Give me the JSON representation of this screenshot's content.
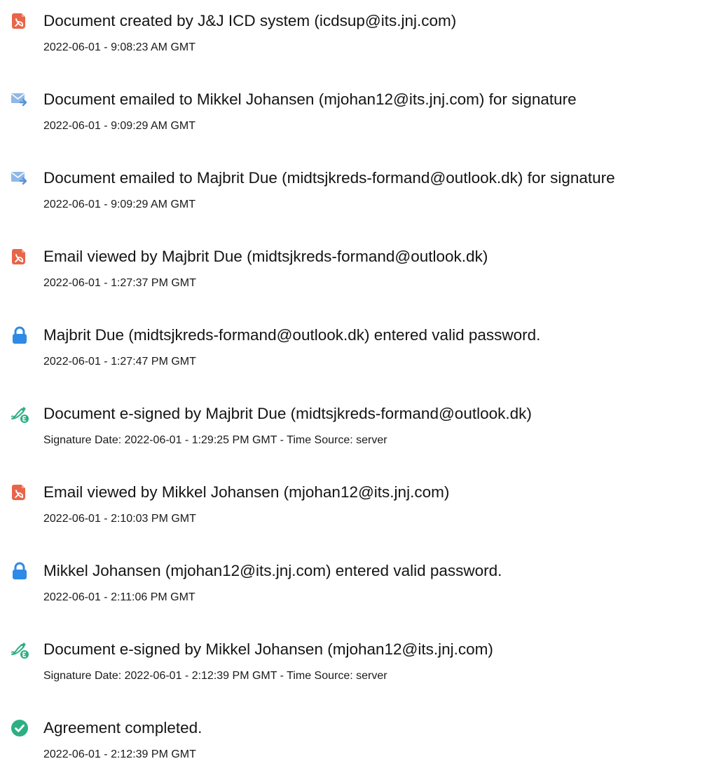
{
  "events": [
    {
      "icon": "pdf-document-icon",
      "title": "Document created by J&J ICD system (icdsup@its.jnj.com)",
      "sub": "2022-06-01 - 9:08:23 AM GMT"
    },
    {
      "icon": "email-sent-icon",
      "title": "Document emailed to Mikkel Johansen (mjohan12@its.jnj.com) for signature",
      "sub": "2022-06-01 - 9:09:29 AM GMT"
    },
    {
      "icon": "email-sent-icon",
      "title": "Document emailed to Majbrit Due (midtsjkreds-formand@outlook.dk) for signature",
      "sub": "2022-06-01 - 9:09:29 AM GMT"
    },
    {
      "icon": "pdf-document-icon",
      "title": "Email viewed by Majbrit Due (midtsjkreds-formand@outlook.dk)",
      "sub": "2022-06-01 - 1:27:37 PM GMT"
    },
    {
      "icon": "lock-icon",
      "title": "Majbrit Due (midtsjkreds-formand@outlook.dk) entered valid password.",
      "sub": "2022-06-01 - 1:27:47 PM GMT"
    },
    {
      "icon": "esign-pen-icon",
      "title": "Document e-signed by Majbrit Due (midtsjkreds-formand@outlook.dk)",
      "sub": "Signature Date: 2022-06-01 - 1:29:25 PM GMT - Time Source: server"
    },
    {
      "icon": "pdf-document-icon",
      "title": "Email viewed by Mikkel Johansen (mjohan12@its.jnj.com)",
      "sub": "2022-06-01 - 2:10:03 PM GMT"
    },
    {
      "icon": "lock-icon",
      "title": "Mikkel Johansen (mjohan12@its.jnj.com) entered valid password.",
      "sub": "2022-06-01 - 2:11:06 PM GMT"
    },
    {
      "icon": "esign-pen-icon",
      "title": "Document e-signed by Mikkel Johansen (mjohan12@its.jnj.com)",
      "sub": "Signature Date: 2022-06-01 - 2:12:39 PM GMT - Time Source: server"
    },
    {
      "icon": "check-circle-icon",
      "title": "Agreement completed.",
      "sub": "2022-06-01 - 2:12:39 PM GMT"
    }
  ],
  "colors": {
    "pdf": "#e8654a",
    "email": "#8fb8e8",
    "lock": "#2d8ae6",
    "esign": "#2fae84",
    "check": "#2fae84"
  }
}
